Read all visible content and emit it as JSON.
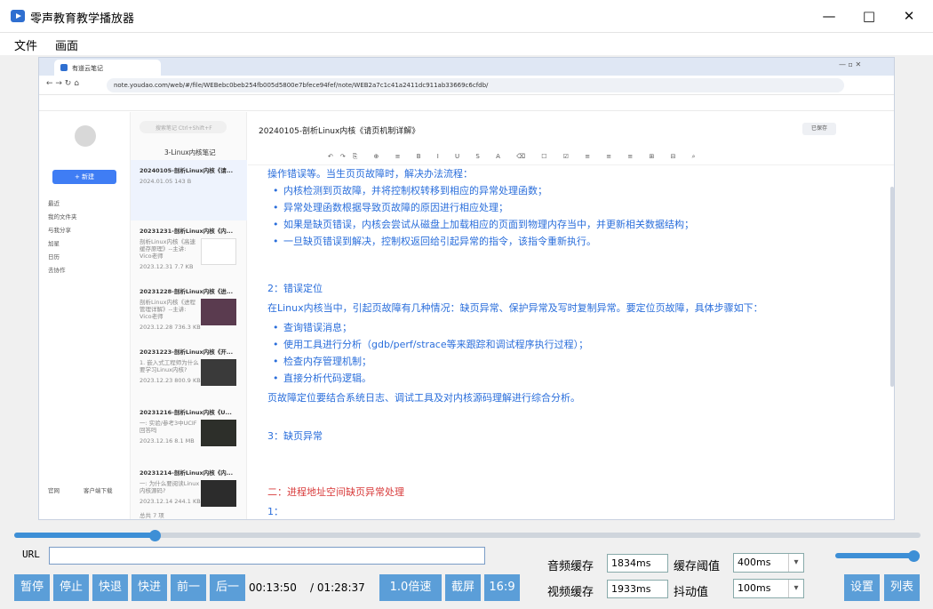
{
  "window": {
    "title": "零声教育教学播放器",
    "minimize_icon": "minimize-icon",
    "maximize_icon": "maximize-icon",
    "close_icon": "close-icon"
  },
  "menu": {
    "file": "文件",
    "view": "画面"
  },
  "browser": {
    "tab_title": "有道云笔记",
    "url": "note.youdao.com/web/#/file/WEBebc0beb254fb005d5800e7bfece94fef/note/WEB2a7c1c41a2411dc911ab33669c6cfdb/"
  },
  "note_app": {
    "sidebar": {
      "new_label": "+ 新建",
      "items": [
        "最近",
        "我的文件夹",
        "与我分享",
        "加星",
        "日历",
        "去协作"
      ],
      "bottom": [
        "官网",
        "客户端下载"
      ]
    },
    "search_placeholder": "搜索笔记 Ctrl+Shift+F",
    "folder": "3-Linux内核笔记",
    "notes": [
      {
        "title": "20240105-剖析Linux内核《请...",
        "snippet": "",
        "date": "2024.01.05   143 B"
      },
      {
        "title": "20231231-剖析Linux内核《内...",
        "snippet": "剖析Linux内核《高速缓存原理》--主讲: Vico老师",
        "date": "2023.12.31   7.7 KB"
      },
      {
        "title": "20231228-剖析Linux内核《进...",
        "snippet": "剖析Linux内核《进程管理详解》--主讲: Vico老师",
        "date": "2023.12.28   736.3 KB"
      },
      {
        "title": "20231223-剖析Linux内核《开...",
        "snippet": "1. 嵌入式工程师为什么要学习Linux内核?",
        "date": "2023.12.23   800.9 KB"
      },
      {
        "title": "20231216-剖析Linux内核《U...",
        "snippet": "一: 实验/参考3中UCIF回答吗",
        "date": "2023.12.16   8.1 MB"
      },
      {
        "title": "20231214-剖析Linux内核《内...",
        "snippet": "一: 为什么要阅读Linux内核源码?",
        "date": "2023.12.14   244.1 KB"
      }
    ],
    "total": "总共 7 项",
    "doc_title": "20240105-剖析Linux内核《请页机制详解》",
    "saved": "已保存",
    "content": {
      "p1": "操作错误等。当生页页故障时，解决办法流程：",
      "list1": [
        "内核检测到页故障，并将控制权转移到相应的异常处理函数；",
        "异常处理函数根据导致页故障的原因进行相应处理；",
        "如果是缺页错误，内核会尝试从磁盘上加载相应的页面到物理内存当中，并更新相关数据结构；",
        "一旦缺页错误到解决，控制权返回给引起异常的指令，该指令重新执行。"
      ],
      "h2": "2：错误定位",
      "p2": "在Linux内核当中，引起页故障有几种情况：缺页异常、保护异常及写时复制异常。要定位页故障，具体步骤如下：",
      "list2": [
        "查询错误消息；",
        "使用工具进行分析（gdb/perf/strace等来跟踪和调试程序执行过程）；",
        "检查内存管理机制；",
        "直接分析代码逻辑。"
      ],
      "p3": "页故障定位要结合系统日志、调试工具及对内核源码理解进行综合分析。",
      "h3": "3：缺页异常",
      "h4": "二：进程地址空间缺页异常处理",
      "h5": "1："
    }
  },
  "player": {
    "progress": 0.155,
    "volume": 0.93,
    "url_label": "URL",
    "url_value": "",
    "buttons": [
      "暂停",
      "停止",
      "快退",
      "快进",
      "前一",
      "后一"
    ],
    "current_time": "00:13:50",
    "total_time": "/ 01:28:37",
    "speed": "1.0倍速",
    "screenshot": "截屏",
    "ratio": "16:9",
    "audio_cache_label": "音频缓存",
    "audio_cache": "1834ms",
    "video_cache_label": "视频缓存",
    "video_cache": "1933ms",
    "cache_threshold_label": "缓存阈值",
    "cache_threshold": "400ms",
    "jitter_label": "抖动值",
    "jitter": "100ms",
    "settings": "设置",
    "list": "列表"
  }
}
